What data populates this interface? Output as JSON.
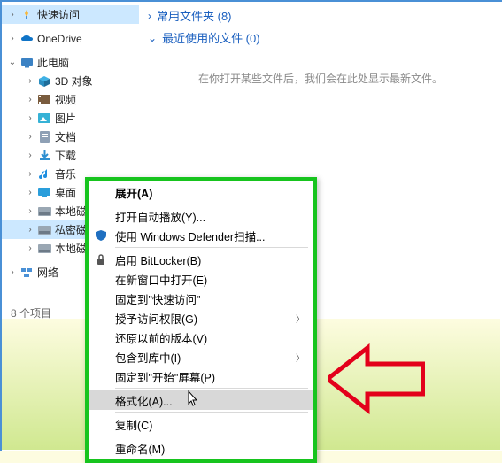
{
  "tree": {
    "quick_access": "快速访问",
    "onedrive": "OneDrive",
    "this_pc": "此电脑",
    "children": {
      "objects3d": "3D 对象",
      "videos": "视频",
      "pictures": "图片",
      "documents": "文档",
      "downloads": "下载",
      "music": "音乐",
      "desktop": "桌面",
      "disk1": "本地磁盘",
      "disk_secret": "私密磁盘",
      "disk2": "本地磁盘"
    },
    "network": "网络"
  },
  "status": "8 个项目",
  "content": {
    "frequent": "常用文件夹 (8)",
    "recent": "最近使用的文件 (0)",
    "empty_hint": "在你打开某些文件后，我们会在此处显示最新文件。"
  },
  "ctx": {
    "expand": "展开(A)",
    "autoplay": "打开自动播放(Y)...",
    "defender": "使用 Windows Defender扫描...",
    "bitlocker": "启用 BitLocker(B)",
    "new_window": "在新窗口中打开(E)",
    "pin_quick": "固定到\"快速访问\"",
    "access": "授予访问权限(G)",
    "restore": "还原以前的版本(V)",
    "include_lib": "包含到库中(I)",
    "pin_start": "固定到\"开始\"屏幕(P)",
    "format": "格式化(A)...",
    "copy": "复制(C)",
    "rename": "重命名(M)"
  },
  "colors": {
    "accent": "#17c41e",
    "link": "#1a5fbf",
    "sel": "#cce8ff"
  }
}
